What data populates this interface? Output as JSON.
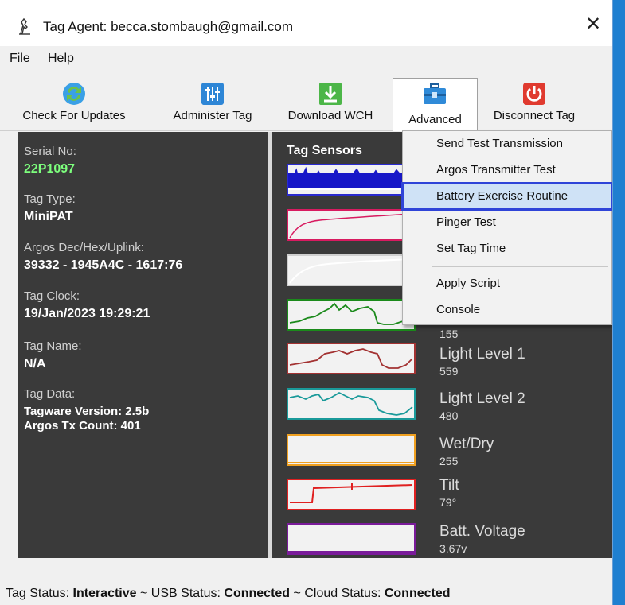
{
  "window": {
    "title": "Tag Agent: becca.stombaugh@gmail.com",
    "close_glyph": "✕"
  },
  "menu": {
    "file": "File",
    "help": "Help"
  },
  "toolbar": {
    "check_updates": "Check For Updates",
    "administer_tag": "Administer Tag",
    "download_wch": "Download WCH",
    "advanced": "Advanced",
    "disconnect_tag": "Disconnect Tag"
  },
  "info": {
    "serial_label": "Serial No:",
    "serial_value": "22P1097",
    "type_label": "Tag Type:",
    "type_value": "MiniPAT",
    "argos_label": "Argos Dec/Hex/Uplink:",
    "argos_value": "39332 - 1945A4C - 1617:76",
    "clock_label": "Tag Clock:",
    "clock_value": "19/Jan/2023 19:29:21",
    "name_label": "Tag Name:",
    "name_value": "N/A",
    "data_label": "Tag Data:",
    "data_line1": "Tagware Version: 2.5b",
    "data_line2": "Argos Tx Count: 401"
  },
  "sensors": {
    "title": "Tag Sensors",
    "partial_value": "155",
    "light1_name": "Light Level 1",
    "light1_value": "559",
    "light2_name": "Light Level 2",
    "light2_value": "480",
    "wetdry_name": "Wet/Dry",
    "wetdry_value": "255",
    "tilt_name": "Tilt",
    "tilt_value": "79°",
    "batt_name": "Batt. Voltage",
    "batt_value": "3.67v"
  },
  "colors": {
    "serial_value": "#7dff7d",
    "highlight_border": "#2f44d8"
  },
  "dropdown": {
    "send_test": "Send Test Transmission",
    "argos_test": "Argos Transmitter Test",
    "battery_exercise": "Battery Exercise Routine",
    "pinger_test": "Pinger Test",
    "set_tag_time": "Set Tag Time",
    "apply_script": "Apply Script",
    "console": "Console"
  },
  "status": {
    "tag_label": "Tag Status:",
    "tag_value": "Interactive",
    "sep1": "~",
    "usb_label": "USB Status:",
    "usb_value": "Connected",
    "sep2": "~",
    "cloud_label": "Cloud Status:",
    "cloud_value": "Connected"
  }
}
